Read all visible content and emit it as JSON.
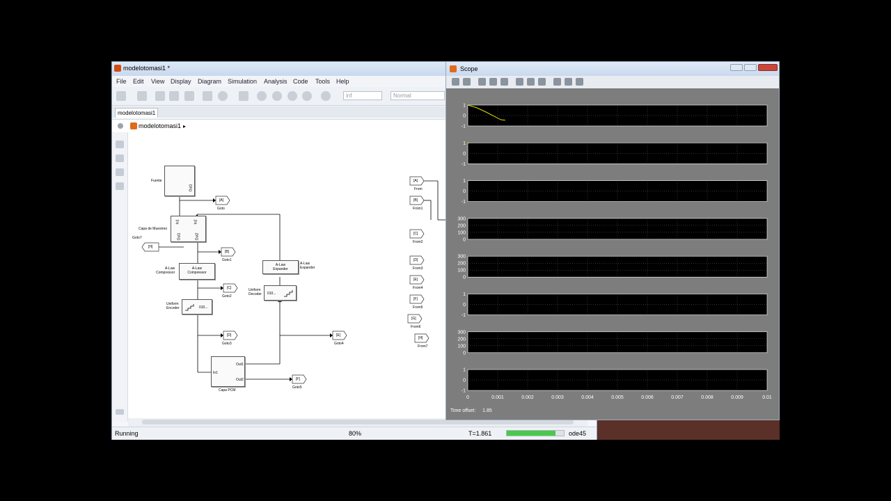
{
  "simulink": {
    "title": "modelotomasi1 *",
    "menu": [
      "File",
      "Edit",
      "View",
      "Display",
      "Diagram",
      "Simulation",
      "Analysis",
      "Code",
      "Tools",
      "Help"
    ],
    "stop_time": "inf",
    "sim_mode": "Normal",
    "tab": "modelotomasi1",
    "breadcrumb": "modelotomasi1",
    "status": {
      "state": "Running",
      "zoom": "80%",
      "time": "T=1.861",
      "solver": "ode45",
      "progress": 0.85
    },
    "blocks": {
      "fuente": "Fuente",
      "out1": "Out1",
      "capa_muestreo": "Capa de Muestreo",
      "in1": "In1",
      "in2": "In2",
      "out2": "Out2",
      "alaw_comp_block": "A-Law\nCompressor",
      "alaw_comp_name": "A-Law\nCompressor",
      "uniform_encoder": "Uniform\nEncoder",
      "uniform_decoder": "Uniform\nDecoder",
      "alaw_exp_block": "A-Law\nExpander",
      "alaw_exp_name": "A-Law\nExpander",
      "capa_pcm": "Capa PCM",
      "enc_val": "010...",
      "dec_val": "010..."
    },
    "gotos": [
      {
        "tag": "[A]",
        "name": "Goto"
      },
      {
        "tag": "[H]",
        "name": "Goto7"
      },
      {
        "tag": "[B]",
        "name": "Goto1"
      },
      {
        "tag": "[C]",
        "name": "Goto2"
      },
      {
        "tag": "[D]",
        "name": "Goto3"
      },
      {
        "tag": "[E]",
        "name": "Goto4"
      },
      {
        "tag": "[F]",
        "name": "Goto5"
      }
    ],
    "froms": [
      {
        "tag": "[A]",
        "name": "From"
      },
      {
        "tag": "[B]",
        "name": "From1"
      },
      {
        "tag": "[C]",
        "name": "From2"
      },
      {
        "tag": "[D]",
        "name": "From3"
      },
      {
        "tag": "[E]",
        "name": "From4"
      },
      {
        "tag": "[F]",
        "name": "From5"
      },
      {
        "tag": "[G]",
        "name": "From6"
      },
      {
        "tag": "[H]",
        "name": "From7"
      }
    ]
  },
  "scope": {
    "title": "Scope",
    "time_offset_label": "Time offset:",
    "time_offset_value": "1.85",
    "trace_color": "#ffff00",
    "axes_bg": "#000000",
    "xticks": [
      "0",
      "0.001",
      "0.002",
      "0.003",
      "0.004",
      "0.005",
      "0.006",
      "0.007",
      "0.008",
      "0.009",
      "0.01"
    ],
    "panels": [
      {
        "yticks": [
          "1",
          "0",
          "-1"
        ],
        "ylim": [
          -1,
          1
        ],
        "trace": [
          [
            0,
            1
          ],
          [
            0.0003,
            0.75
          ],
          [
            0.0006,
            0.35
          ],
          [
            0.0009,
            -0.1
          ],
          [
            0.0011,
            -0.4
          ],
          [
            0.00125,
            -0.45
          ]
        ]
      },
      {
        "yticks": [
          "1",
          "0",
          "-1"
        ],
        "ylim": [
          -1,
          1
        ],
        "trace": [
          [
            0,
            1
          ],
          [
            5e-05,
            1
          ]
        ]
      },
      {
        "yticks": [
          "1",
          "0",
          "-1"
        ],
        "ylim": [
          -1,
          1
        ],
        "trace": []
      },
      {
        "yticks": [
          "300",
          "200",
          "100",
          "0"
        ],
        "ylim": [
          0,
          300
        ],
        "trace": []
      },
      {
        "yticks": [
          "300",
          "200",
          "100",
          "0"
        ],
        "ylim": [
          0,
          300
        ],
        "trace": []
      },
      {
        "yticks": [
          "1",
          "0",
          "-1"
        ],
        "ylim": [
          -1,
          1
        ],
        "trace": []
      },
      {
        "yticks": [
          "300",
          "200",
          "100",
          "0"
        ],
        "ylim": [
          0,
          300
        ],
        "trace": []
      },
      {
        "yticks": [
          "1",
          "0",
          "-1"
        ],
        "ylim": [
          -1,
          1
        ],
        "trace": []
      }
    ]
  }
}
